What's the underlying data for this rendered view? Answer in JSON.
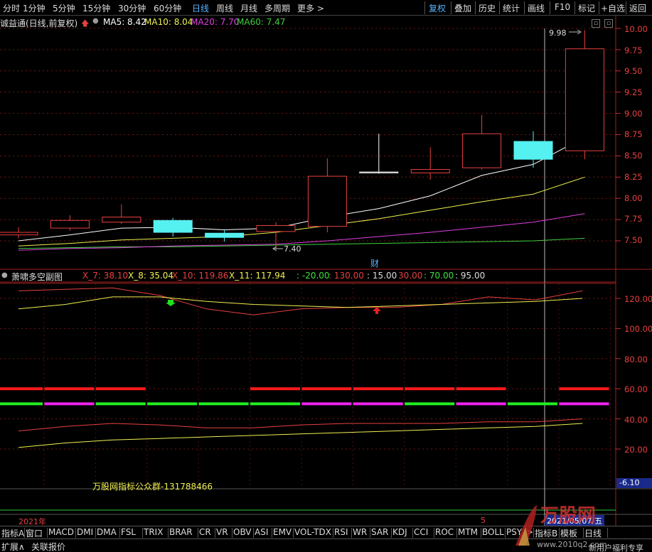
{
  "toolbar": {
    "periods": [
      "分时",
      "1分钟",
      "5分钟",
      "15分钟",
      "30分钟",
      "60分钟",
      "日线",
      "周线",
      "月线",
      "多周期",
      "更多 >"
    ],
    "active_period": "日线",
    "right_buttons": [
      "复权",
      "叠加",
      "历史",
      "统计",
      "画线",
      "F10",
      "标记",
      "+自选",
      "返回"
    ],
    "active_right": "复权"
  },
  "info": {
    "stock_label": "诚益通(日线,前复权)",
    "ma5": "MA5: 8.42",
    "ma10": "MA10: 8.04",
    "ma20": "MA20: 7.70",
    "ma60": "MA60: 7.47"
  },
  "main_chart": {
    "high_mark": "9.98",
    "low_mark": "7.40",
    "event_label": "财",
    "y_ticks": [
      "10.00",
      "9.75",
      "9.50",
      "9.25",
      "9.00",
      "8.75",
      "8.50",
      "8.25",
      "8.00",
      "7.75",
      "7.50"
    ]
  },
  "sub_panel": {
    "title": "萧啸多空副图",
    "x7": "X_7: 38.10",
    "x8": "X_8: 35.04",
    "x10": "X_10: 119.86",
    "x11": "X_11: 117.94",
    "v1": ": -20.00",
    "v2": ": 130.00",
    "v3": ": 15.00",
    "v4": "30.00",
    "v5": ": 70.00",
    "v6": ": 95.00",
    "y_ticks": [
      "120.00",
      "100.00",
      "80.00",
      "60.00",
      "40.00",
      "20.00"
    ],
    "bottom_value": "-6.10",
    "notice": "万股网指标公众群-131788466"
  },
  "date_axis": {
    "start": "2021年",
    "mid": "5",
    "cursor_date": "2021/05/07/五"
  },
  "tabs": [
    "指标A",
    "窗口",
    "MACD",
    "DMI",
    "DMA",
    "FSL",
    "TRIX",
    "BRAR",
    "CR",
    "VR",
    "OBV",
    "ASI",
    "EMV",
    "VOL-TDX",
    "RSI",
    "WR",
    "SAR",
    "KDJ",
    "CCI",
    "ROC",
    "MTM",
    "BOLL",
    "PSY",
    ">",
    "指标B",
    "模板",
    "日线"
  ],
  "bottom_bar": {
    "expand": "扩展∧",
    "related": "关联报价",
    "promo": "新用户福利专享"
  },
  "watermark": {
    "brand": "万股网",
    "url": "www.2010q2.com"
  },
  "colors": {
    "up": "#e84040",
    "down": "#55f0f0",
    "ma5": "#ffffff",
    "ma10": "#f0f050",
    "ma20": "#e040e0",
    "ma60": "#40d040"
  },
  "chart_data": [
    {
      "type": "candlestick",
      "y_axis_ticks": [
        10.0,
        9.75,
        9.5,
        9.25,
        9.0,
        8.75,
        8.5,
        8.25,
        8.0,
        7.75,
        7.5
      ],
      "ylim": [
        7.33,
        10.04
      ],
      "candles": [
        {
          "open": 7.57,
          "close": 7.6,
          "high": 7.66,
          "low": 7.53,
          "dir": "up"
        },
        {
          "open": 7.65,
          "close": 7.74,
          "high": 7.8,
          "low": 7.62,
          "dir": "up"
        },
        {
          "open": 7.72,
          "close": 7.78,
          "high": 7.93,
          "low": 7.7,
          "dir": "up"
        },
        {
          "open": 7.74,
          "close": 7.6,
          "high": 7.77,
          "low": 7.55,
          "dir": "down"
        },
        {
          "open": 7.59,
          "close": 7.54,
          "high": 7.63,
          "low": 7.49,
          "dir": "down"
        },
        {
          "open": 7.61,
          "close": 7.68,
          "high": 7.72,
          "low": 7.4,
          "dir": "up"
        },
        {
          "open": 7.67,
          "close": 8.26,
          "high": 8.47,
          "low": 7.6,
          "dir": "up"
        },
        {
          "open": 8.3,
          "close": 8.31,
          "high": 8.76,
          "low": 8.29,
          "dir": "up"
        },
        {
          "open": 8.3,
          "close": 8.34,
          "high": 8.6,
          "low": 8.22,
          "dir": "up"
        },
        {
          "open": 8.36,
          "close": 8.76,
          "high": 8.98,
          "low": 8.34,
          "dir": "up"
        },
        {
          "open": 8.67,
          "close": 8.46,
          "high": 8.79,
          "low": 8.36,
          "dir": "down"
        },
        {
          "open": 8.56,
          "close": 9.76,
          "high": 9.98,
          "low": 8.46,
          "dir": "up"
        }
      ],
      "ma5": [
        7.5,
        7.57,
        7.65,
        7.66,
        7.63,
        7.65,
        7.78,
        7.88,
        8.03,
        8.27,
        8.4,
        8.72
      ],
      "ma10": [
        7.44,
        7.47,
        7.51,
        7.53,
        7.55,
        7.6,
        7.68,
        7.76,
        7.86,
        7.96,
        8.05,
        8.25
      ],
      "ma20": [
        7.39,
        7.41,
        7.42,
        7.44,
        7.45,
        7.46,
        7.5,
        7.55,
        7.6,
        7.66,
        7.72,
        7.82
      ],
      "ma60": [
        7.41,
        7.42,
        7.43,
        7.43,
        7.44,
        7.45,
        7.46,
        7.47,
        7.48,
        7.49,
        7.5,
        7.53
      ]
    },
    {
      "type": "line",
      "y_axis_ticks": [
        120,
        100,
        80,
        60,
        40,
        20
      ],
      "ylim": [
        -10,
        134
      ],
      "series": [
        {
          "values": [
            125,
            126,
            127,
            122,
            113,
            109,
            113,
            114,
            114,
            116,
            121,
            119,
            125
          ]
        },
        {
          "values": [
            113,
            116,
            121,
            121,
            118,
            116,
            115,
            114,
            115,
            116,
            117,
            118,
            120
          ]
        },
        {
          "values": [
            32,
            35,
            37,
            36,
            34,
            34,
            36,
            37,
            37,
            37,
            38,
            38,
            40
          ]
        },
        {
          "values": [
            21,
            24,
            26,
            27,
            28,
            29,
            30,
            31,
            32,
            33,
            34,
            35,
            37
          ]
        }
      ],
      "signal_level_60": [
        "red",
        "red",
        "red",
        "none",
        "none",
        "red",
        "red",
        "red",
        "red",
        "red",
        "none",
        "red"
      ],
      "signal_level_50": [
        "green",
        "magenta",
        "green",
        "green",
        "green",
        "green",
        "magenta",
        "magenta",
        "green",
        "magenta",
        "green",
        "magenta"
      ]
    }
  ]
}
